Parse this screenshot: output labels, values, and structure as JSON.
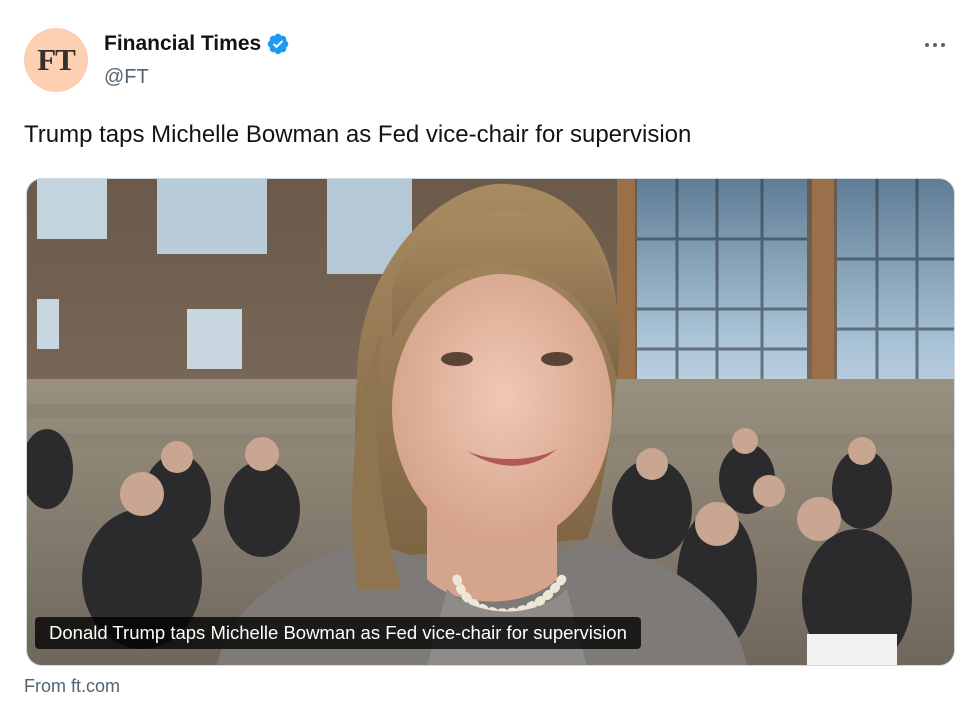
{
  "account": {
    "avatar_text": "FT",
    "display_name": "Financial Times",
    "handle": "@FT",
    "verified": true,
    "avatar_color": "#fcd0b1",
    "verified_color": "#1d9bf0"
  },
  "tweet": {
    "text": "Trump taps Michelle Bowman as Fed vice-chair for supervision"
  },
  "card": {
    "caption": "Donald Trump taps Michelle Bowman as Fed vice-chair for supervision",
    "source": "From ft.com"
  },
  "icons": [
    "verified-badge-icon",
    "more-options-icon"
  ]
}
